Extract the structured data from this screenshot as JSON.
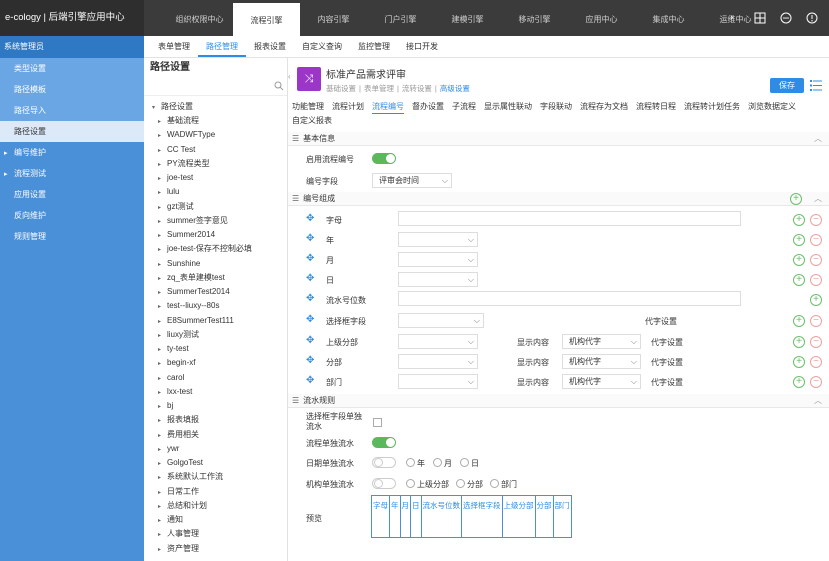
{
  "app": {
    "title": "e-cology | 后端引擎应用中心"
  },
  "topnav": {
    "items": [
      "组织权限中心",
      "流程引擎",
      "内容引擎",
      "门户引擎",
      "建模引擎",
      "移动引擎",
      "应用中心",
      "集成中心",
      "运维中心"
    ],
    "active_index": 1,
    "more": "›"
  },
  "sidebar": {
    "header": "系统管理员",
    "items": [
      {
        "label": "类型设置",
        "kind": "sub"
      },
      {
        "label": "路径模板",
        "kind": "sub"
      },
      {
        "label": "路径导入",
        "kind": "sub"
      },
      {
        "label": "路径设置",
        "kind": "active"
      },
      {
        "label": "编号维护",
        "kind": "parent"
      },
      {
        "label": "流程测试",
        "kind": "parent"
      },
      {
        "label": "应用设置",
        "kind": "plain"
      },
      {
        "label": "反向维护",
        "kind": "plain"
      },
      {
        "label": "规则管理",
        "kind": "plain"
      }
    ]
  },
  "subnav": {
    "items": [
      "表单管理",
      "路径管理",
      "报表设置",
      "自定义查询",
      "监控管理",
      "接口开发"
    ],
    "active_index": 1
  },
  "tree": {
    "title": "路径设置",
    "root": "路径设置",
    "nodes": [
      "基础流程",
      "WADWFType",
      "CC Test",
      "PY流程类型",
      "joe-test",
      "lulu",
      "gzt测试",
      "summer签字意见",
      "Summer2014",
      "joe-test-保存不控制必填",
      "Sunshine",
      "zq_表单建模test",
      "SummerTest2014",
      "test--liuxy--80s",
      "E8SummerTest111",
      "liuxy测试",
      "ty-test",
      "begin-xf",
      "carol",
      "lxx-test",
      "bj",
      "报表填报",
      "费用相关",
      "ywr",
      "GolgoTest",
      "系统默认工作流",
      "日常工作",
      "总结和计划",
      "通知",
      "人事管理",
      "资产管理"
    ]
  },
  "workflow": {
    "title": "标准产品需求评审",
    "steps": [
      "基础设置",
      "表单管理",
      "流转设置",
      "高级设置"
    ],
    "current_step": 3,
    "save_label": "保存"
  },
  "tabs": {
    "items": [
      "功能管理",
      "流程计划",
      "流程编号",
      "督办设置",
      "子流程",
      "显示属性联动",
      "字段联动",
      "流程存为文档",
      "流程转日程",
      "流程转计划任务",
      "浏览数据定义",
      "自定义报表"
    ],
    "active_index": 2
  },
  "basic_info": {
    "section_title": "基本信息",
    "enable_label": "启用流程编号",
    "enable_on": true,
    "field_label": "编号字段",
    "field_value": "评审会时间"
  },
  "composition": {
    "section_title": "编号组成",
    "rows": [
      {
        "label": "字母",
        "control": "input"
      },
      {
        "label": "年",
        "control": "select"
      },
      {
        "label": "月",
        "control": "select"
      },
      {
        "label": "日",
        "control": "select"
      },
      {
        "label": "流水号位数",
        "control": "input-long"
      },
      {
        "label": "选择框字段",
        "control": "select",
        "extra": "代字设置"
      },
      {
        "label": "上级分部",
        "control": "select",
        "show_label": "显示内容",
        "show_value": "机构代字",
        "extra": "代字设置"
      },
      {
        "label": "分部",
        "control": "select",
        "show_label": "显示内容",
        "show_value": "机构代字",
        "extra": "代字设置"
      },
      {
        "label": "部门",
        "control": "select",
        "show_label": "显示内容",
        "show_value": "机构代字",
        "extra": "代字设置"
      }
    ]
  },
  "serial": {
    "section_title": "流水规则",
    "select_field_label": "选择框字段单独流水",
    "workflow_label": "流程单独流水",
    "workflow_on": true,
    "date_label": "日期单独流水",
    "date_on": false,
    "date_options": [
      "年",
      "月",
      "日"
    ],
    "org_label": "机构单独流水",
    "org_on": false,
    "org_options": [
      "上级分部",
      "分部",
      "部门"
    ],
    "preview_label": "预览",
    "preview_cols": [
      "字母",
      "年",
      "月",
      "日",
      "流水号位数",
      "选择框字段",
      "上级分部",
      "分部",
      "部门"
    ]
  },
  "colors": {
    "accent": "#2d8ce8",
    "sidebar": "#4a90d9",
    "topbar": "#3b3b3b",
    "toggle_on": "#5cb85c",
    "app_icon": "#9c36c9"
  },
  "icons": {
    "grid": "grid-icon",
    "history": "history-icon",
    "more": "more-icon",
    "search": "search-icon",
    "menu": "menu-icon",
    "move": "move-icon",
    "add": "add-icon",
    "remove": "remove-icon"
  }
}
